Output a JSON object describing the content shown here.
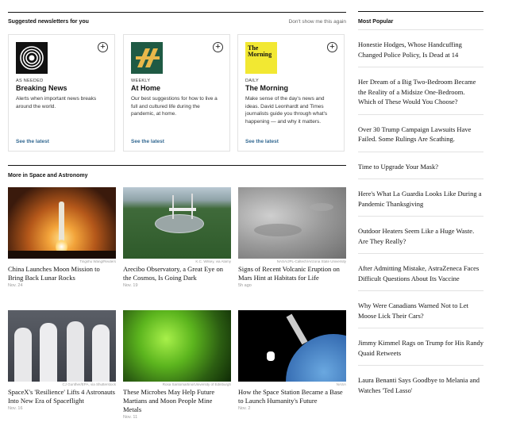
{
  "newsletters": {
    "heading": "Suggested newsletters for you",
    "dismiss": "Don't show me this again",
    "cards": [
      {
        "frequency": "AS NEEDED",
        "name": "Breaking News",
        "description": "Alerts when important news breaks around the world.",
        "link": "See the latest"
      },
      {
        "frequency": "WEEKLY",
        "name": "At Home",
        "description": "Our best suggestions for how to live a full and cultured life during the pandemic, at home.",
        "link": "See the latest"
      },
      {
        "frequency": "DAILY",
        "name": "The Morning",
        "description": "Make sense of the day's news and ideas. David Leonhardt and Times journalists guide you through what's happening — and why it matters.",
        "link": "See the latest",
        "logo_text": "The Morning"
      }
    ]
  },
  "space": {
    "heading": "More in Space and Astronomy",
    "stories": [
      {
        "credit": "Tingshu Wang/Reuters",
        "headline": "China Launches Moon Mission to Bring Back Lunar Rocks",
        "date": "Nov. 24"
      },
      {
        "credit": "K.C. Wilsey, via Alamy",
        "headline": "Arecibo Observatory, a Great Eye on the Cosmos, Is Going Dark",
        "date": "Nov. 19"
      },
      {
        "credit": "NASA/JPL-Caltech/Arizona State University",
        "headline": "Signs of Recent Volcanic Eruption on Mars Hint at Habitats for Life",
        "date": "5h ago"
      },
      {
        "credit": "CJ Gunther/EPA, via Shutterstock",
        "headline": "SpaceX's 'Resilience' Lifts 4 Astronauts Into New Era of Spaceflight",
        "date": "Nov. 16"
      },
      {
        "credit": "Rosa Santomartino/University of Edinburgh",
        "headline": "These Microbes May Help Future Martians and Moon People Mine Metals",
        "date": "Nov. 11"
      },
      {
        "credit": "NASA",
        "headline": "How the Space Station Became a Base to Launch Humanity's Future",
        "date": "Nov. 2"
      }
    ]
  },
  "most_popular": {
    "heading": "Most Popular",
    "items": [
      "Honestie Hodges, Whose Handcuffing Changed Police Policy, Is Dead at 14",
      "Her Dream of a Big Two-Bedroom Became the Reality of a Midsize One-Bedroom. Which of These Would You Choose?",
      "Over 30 Trump Campaign Lawsuits Have Failed. Some Rulings Are Scathing.",
      "Time to Upgrade Your Mask?",
      "Here's What La Guardia Looks Like During a Pandemic Thanksgiving",
      "Outdoor Heaters Seem Like a Huge Waste. Are They Really?",
      "After Admitting Mistake, AstraZeneca Faces Difficult Questions About Its Vaccine",
      "Why Were Canadians Warned Not to Let Moose Lick Their Cars?",
      "Jimmy Kimmel Rags on Trump for His Randy Quaid Retweets",
      "Laura Benanti Says Goodbye to Melania and Watches 'Ted Lasso'"
    ]
  }
}
